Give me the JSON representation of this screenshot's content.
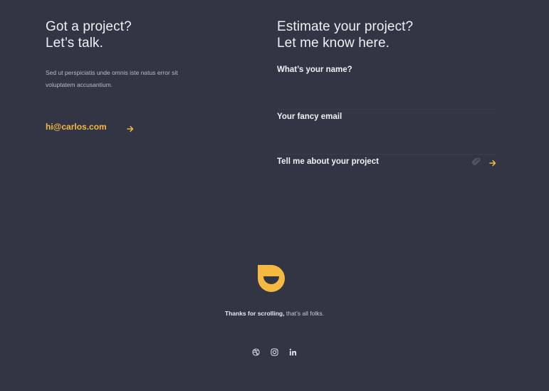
{
  "contact": {
    "heading_line1": "Got a project?",
    "heading_line2": "Let’s talk.",
    "intro": "Sed ut perspiciatis unde omnis iste natus error sit voluptatem accusantium.",
    "email": "hi@carlos.com"
  },
  "estimate": {
    "heading_line1": "Estimate your project?",
    "heading_line2": "Let me know here.",
    "name_placeholder": "What’s your name?",
    "email_placeholder": "Your fancy email",
    "project_placeholder": "Tell me about your project"
  },
  "footer": {
    "thanks_bold": "Thanks for scrolling,",
    "thanks_rest": " that’s all folks.",
    "socials": [
      "dribbble-icon",
      "instagram-icon",
      "linkedin-icon"
    ]
  },
  "colors": {
    "background": "#323544",
    "accent": "#f5b942",
    "text": "#eef0f4"
  }
}
